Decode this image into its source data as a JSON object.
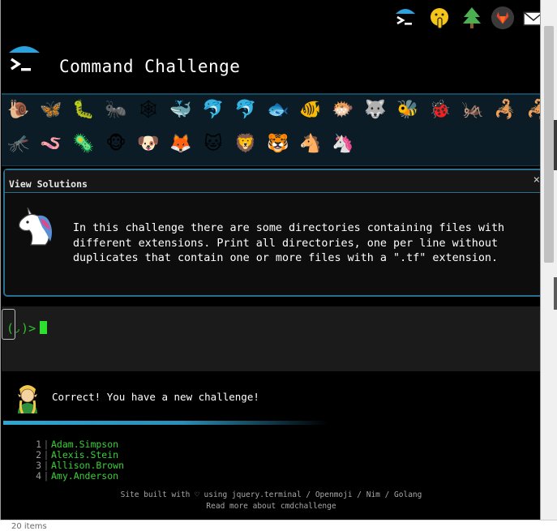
{
  "app": {
    "title": "Command Challenge"
  },
  "nav": {
    "icons": [
      "brand-icon",
      "shushing-face-icon",
      "tree-icon",
      "gitlab-icon",
      "mail-icon"
    ]
  },
  "animals": [
    "🐌",
    "🦋",
    "🐛",
    "🐜",
    "🕸",
    "🐳",
    "🐬",
    "🐬",
    "🐟",
    "🐠",
    "🐡",
    "🐺",
    "🐝",
    "🐞",
    "🦗",
    "🦂",
    "🦂",
    "🦟",
    "🪱",
    "🦠",
    "🐵",
    "🐶",
    "🦊",
    "🐱",
    "🦁",
    "🐯",
    "🐴",
    "🦄"
  ],
  "panel": {
    "header": "View Solutions",
    "close": "×",
    "challenge_text": "In this challenge there are some directories containing files with\ndifferent extensions. Print all directories, one per line without\nduplicates that contain one or more files with a \".tf\" extension."
  },
  "terminal": {
    "prompt": "(◞)>"
  },
  "result": {
    "message": "Correct! You have a new challenge!"
  },
  "output": {
    "rows": [
      {
        "n": "1",
        "name": "Adam.Simpson"
      },
      {
        "n": "2",
        "name": "Alexis.Stein"
      },
      {
        "n": "3",
        "name": "Allison.Brown"
      },
      {
        "n": "4",
        "name": "Amy.Anderson"
      }
    ]
  },
  "footer": {
    "line1": "Site built with ♡ using jquery.terminal / Openmoji / Nim / Golang",
    "line2": "Read more about cmdchallenge"
  },
  "status": {
    "items": "20 items"
  },
  "colors": {
    "accent": "#2a6f90",
    "terminal_green": "#39d039",
    "bg": "#000000"
  }
}
